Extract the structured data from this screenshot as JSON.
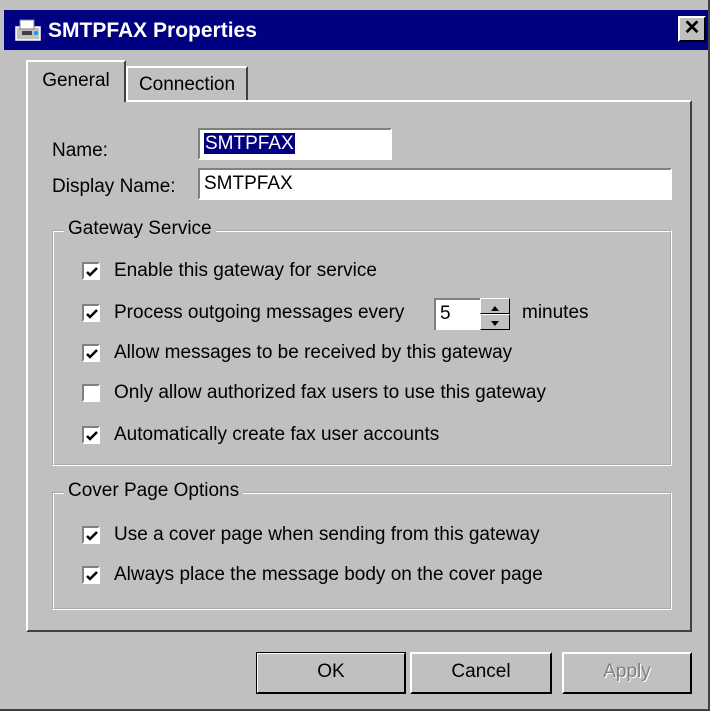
{
  "window": {
    "title": "SMTPFAX Properties",
    "close_label": "✕"
  },
  "tabs": [
    {
      "label": "General"
    },
    {
      "label": "Connection"
    }
  ],
  "fields": {
    "name_label": "Name:",
    "name_value": "SMTPFAX",
    "display_name_label": "Display Name:",
    "display_name_value": "SMTPFAX"
  },
  "gateway_service": {
    "title": "Gateway Service",
    "options": [
      {
        "label": "Enable this gateway for service",
        "checked": true
      },
      {
        "label": "Process outgoing messages every",
        "checked": true
      },
      {
        "label": "Allow messages to be received by this gateway",
        "checked": true
      },
      {
        "label": "Only allow authorized fax users to use this gateway",
        "checked": false
      },
      {
        "label": "Automatically create fax user accounts",
        "checked": true
      }
    ],
    "interval_value": "5",
    "interval_unit": "minutes"
  },
  "cover_page": {
    "title": "Cover Page Options",
    "options": [
      {
        "label": "Use a cover page when sending from this gateway",
        "checked": true
      },
      {
        "label": "Always place the message body on the cover page",
        "checked": true
      }
    ]
  },
  "buttons": {
    "ok": "OK",
    "cancel": "Cancel",
    "apply": "Apply"
  },
  "icons": {
    "app": "fax-machine-icon",
    "check": "checkmark-icon",
    "spin_up": "arrow-up-icon",
    "spin_down": "arrow-down-icon"
  }
}
